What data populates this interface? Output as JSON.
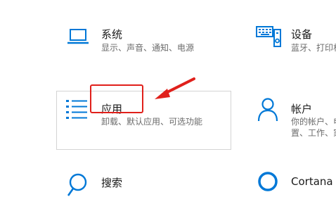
{
  "settings": {
    "system": {
      "title": "系统",
      "desc": "显示、声音、通知、电源",
      "icon": "laptop-icon"
    },
    "devices": {
      "title": "设备",
      "desc_line1": "蓝牙、打印机",
      "icon": "keyboard-printer-icon"
    },
    "apps": {
      "title": "应用",
      "desc": "卸载、默认应用、可选功能",
      "icon": "apps-list-icon"
    },
    "accounts": {
      "title": "帐户",
      "desc_line1": "你的帐户、电",
      "desc_line2": "置、工作、家",
      "icon": "person-icon"
    },
    "search": {
      "title": "搜索",
      "icon": "search-icon"
    },
    "cortana": {
      "title": "Cortana",
      "icon": "cortana-icon"
    }
  },
  "colors": {
    "accent": "#0078d7",
    "annotation": "#e0201b"
  }
}
